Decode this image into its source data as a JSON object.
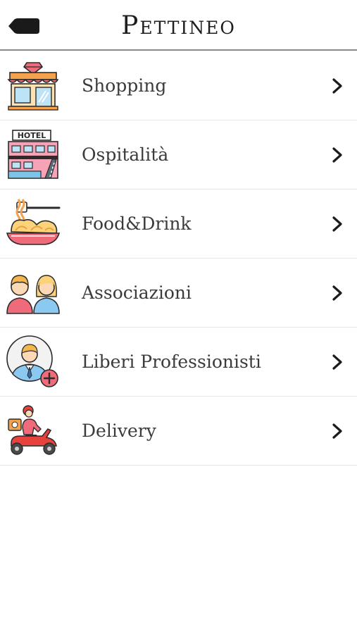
{
  "header": {
    "title": "Pettineo",
    "back_icon": "back-arrow-icon"
  },
  "menu": {
    "items": [
      {
        "label": "Shopping",
        "icon": "storefront-icon"
      },
      {
        "label": "Ospitalità",
        "icon": "hotel-icon"
      },
      {
        "label": "Food&Drink",
        "icon": "spaghetti-icon"
      },
      {
        "label": "Associazioni",
        "icon": "people-icon"
      },
      {
        "label": "Liberi Professionisti",
        "icon": "professional-icon"
      },
      {
        "label": "Delivery",
        "icon": "delivery-scooter-icon"
      }
    ],
    "chevron_icon": "chevron-right-icon"
  },
  "colors": {
    "title": "#1e1e1e",
    "label": "#3b3b3b",
    "divider": "#e6e6e6",
    "header_border": "#8a8a8a"
  }
}
